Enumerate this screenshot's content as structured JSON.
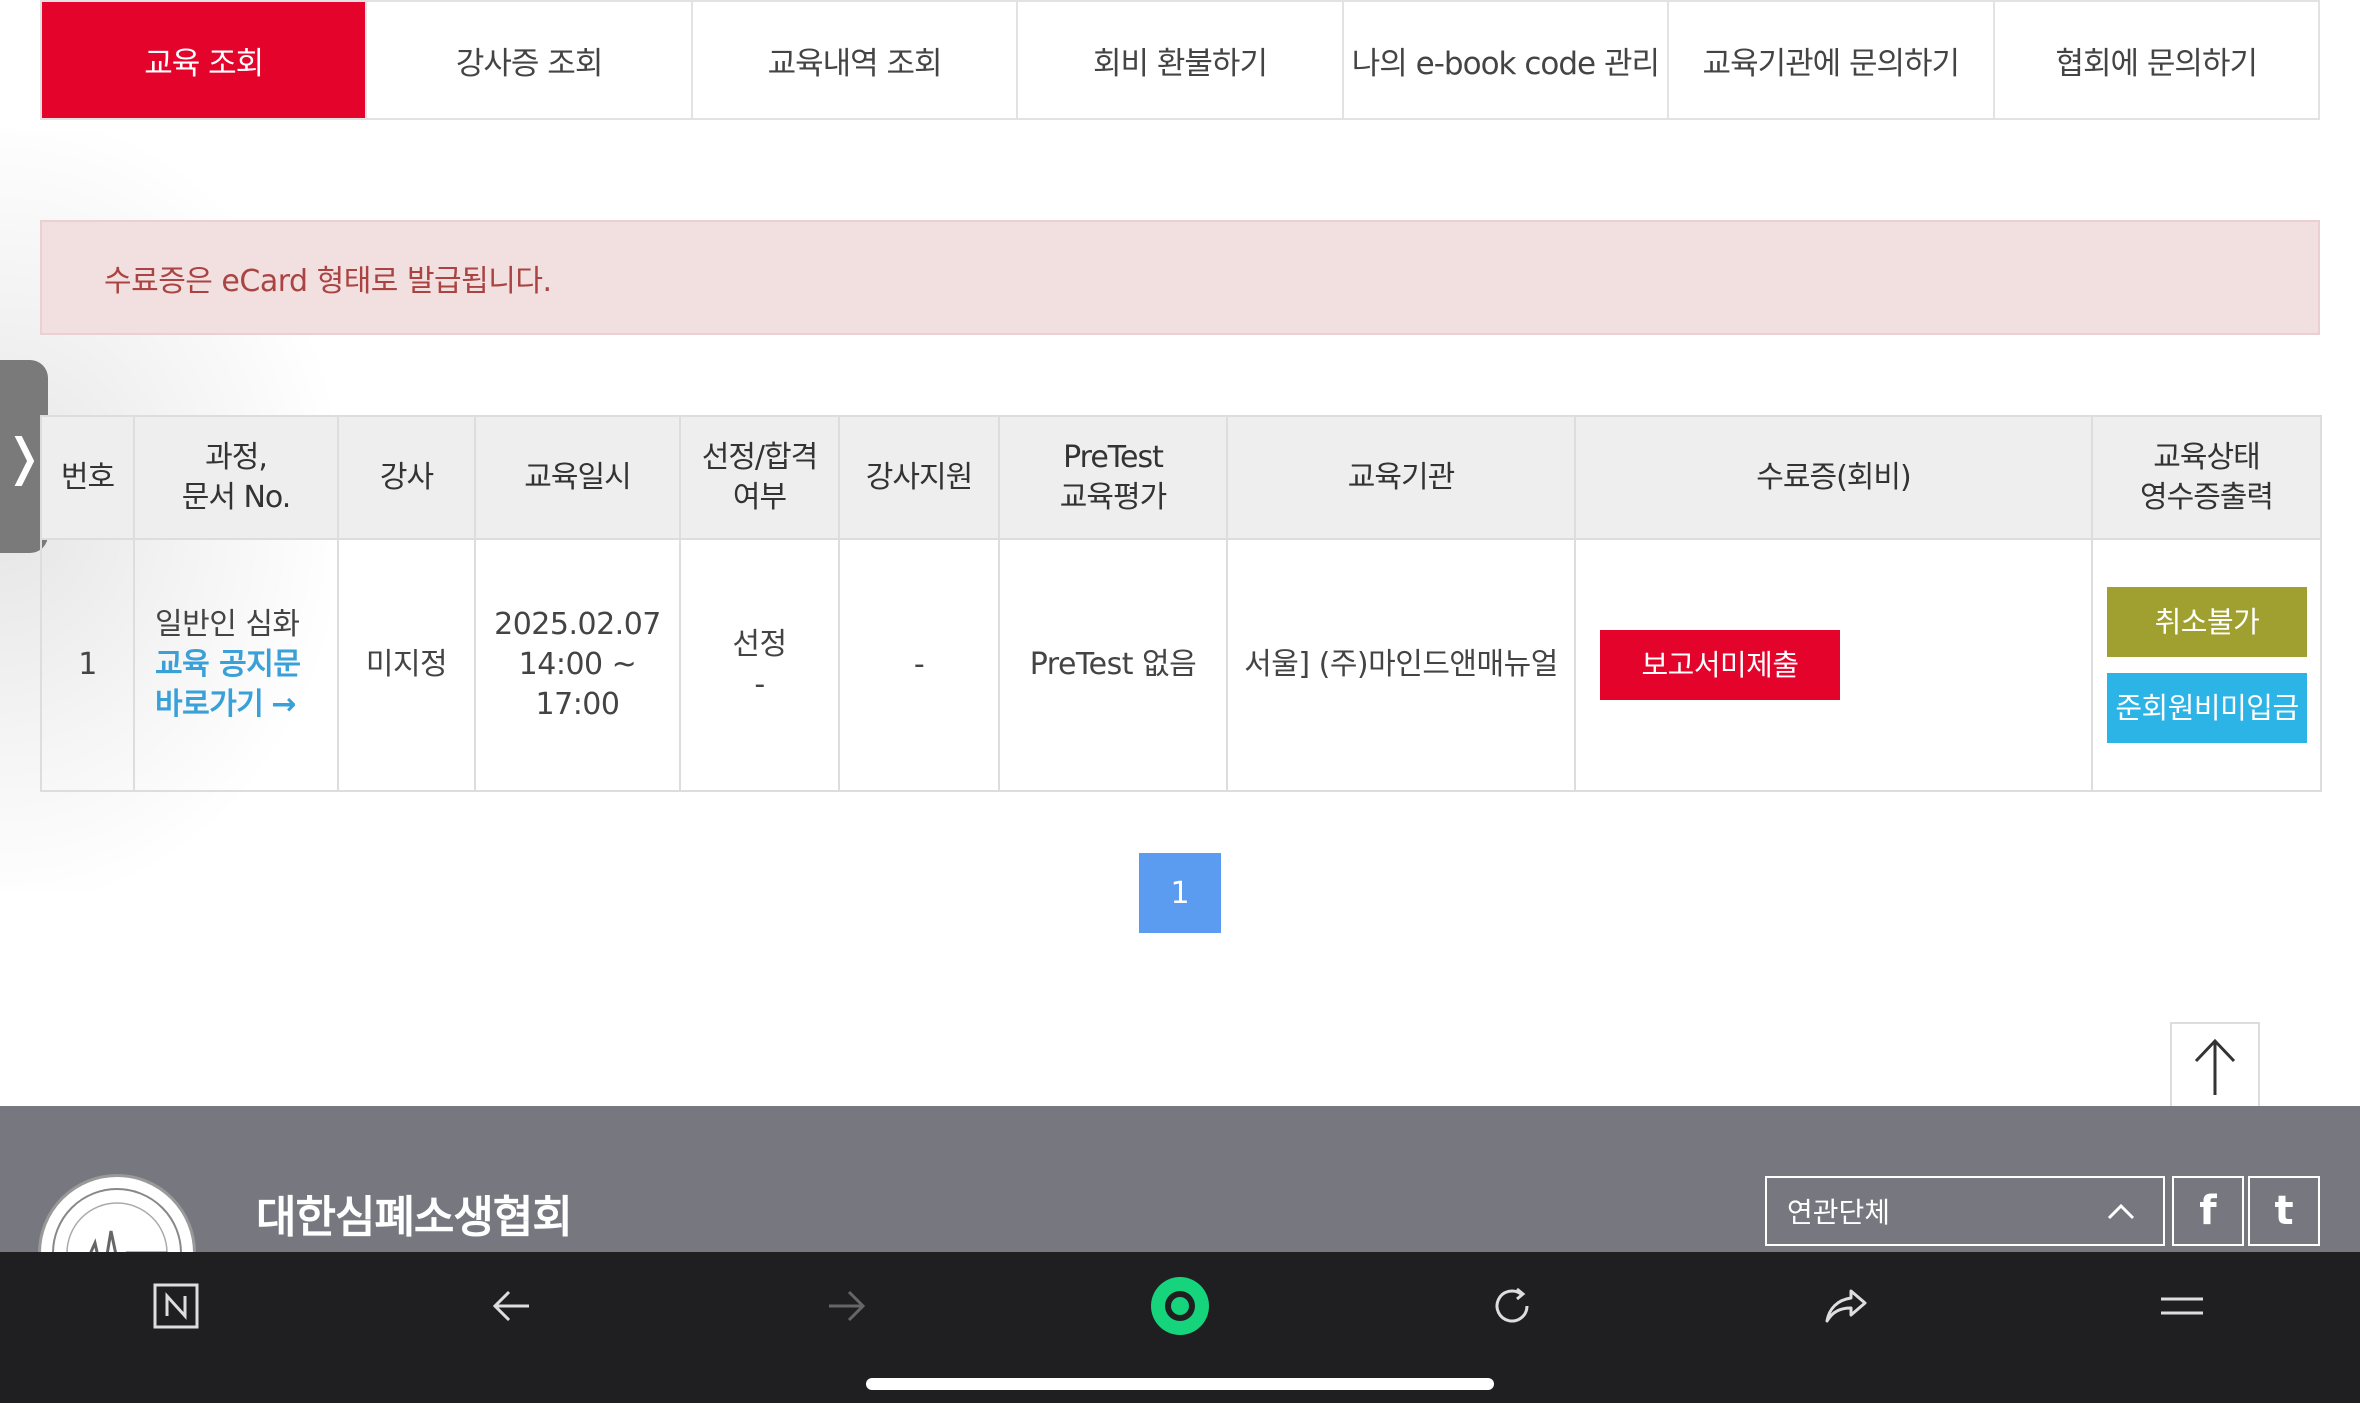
{
  "tabs": [
    {
      "label": "교육 조회",
      "active": true
    },
    {
      "label": "강사증 조회",
      "active": false
    },
    {
      "label": "교육내역 조회",
      "active": false
    },
    {
      "label": "회비 환불하기",
      "active": false
    },
    {
      "label": "나의 e-book code 관리",
      "active": false
    },
    {
      "label": "교육기관에 문의하기",
      "active": false
    },
    {
      "label": "협회에 문의하기",
      "active": false
    }
  ],
  "drawer": {
    "handle_glyph": "❭"
  },
  "notice": {
    "text": "수료증은 eCard 형태로 발급됩니다."
  },
  "table": {
    "headers": {
      "no": "번호",
      "course_1": "과정,",
      "course_2": "문서 No.",
      "instructor": "강사",
      "date": "교육일시",
      "select_1": "선정/합격",
      "select_2": "여부",
      "instructor_support": "강사지원",
      "pretest_1": "PreTest",
      "pretest_2": "교육평가",
      "institution": "교육기관",
      "certificate": "수료증(회비)",
      "status_1": "교육상태",
      "status_2": "영수증출력"
    },
    "rows": [
      {
        "no": "1",
        "course_name": "일반인 심화",
        "notice_link_1": "교육 공지문",
        "notice_link_2": "바로가기",
        "instructor": "미지정",
        "date_1": "2025.02.07",
        "date_2": "14:00 ~ 17:00",
        "select_1": "선정",
        "select_2": "-",
        "instructor_support": "-",
        "pretest": "PreTest 없음",
        "institution": "서울] (주)마인드앤매뉴얼",
        "report_button": "보고서미제출",
        "no_cancel_button": "취소불가",
        "unpaid_button": "준회원비미입금"
      }
    ]
  },
  "pagination": {
    "current": "1"
  },
  "footer": {
    "org_name": "대한심폐소생협회",
    "related_select": "연관단체",
    "facebook": "f",
    "twitter": "t"
  },
  "colors": {
    "accent_red": "#e4032b",
    "olive": "#a0a031",
    "sky": "#2db4e6",
    "page_blue": "#5b9cf0",
    "footer_gray": "#77777f",
    "browser_bar": "#1f1f22"
  }
}
